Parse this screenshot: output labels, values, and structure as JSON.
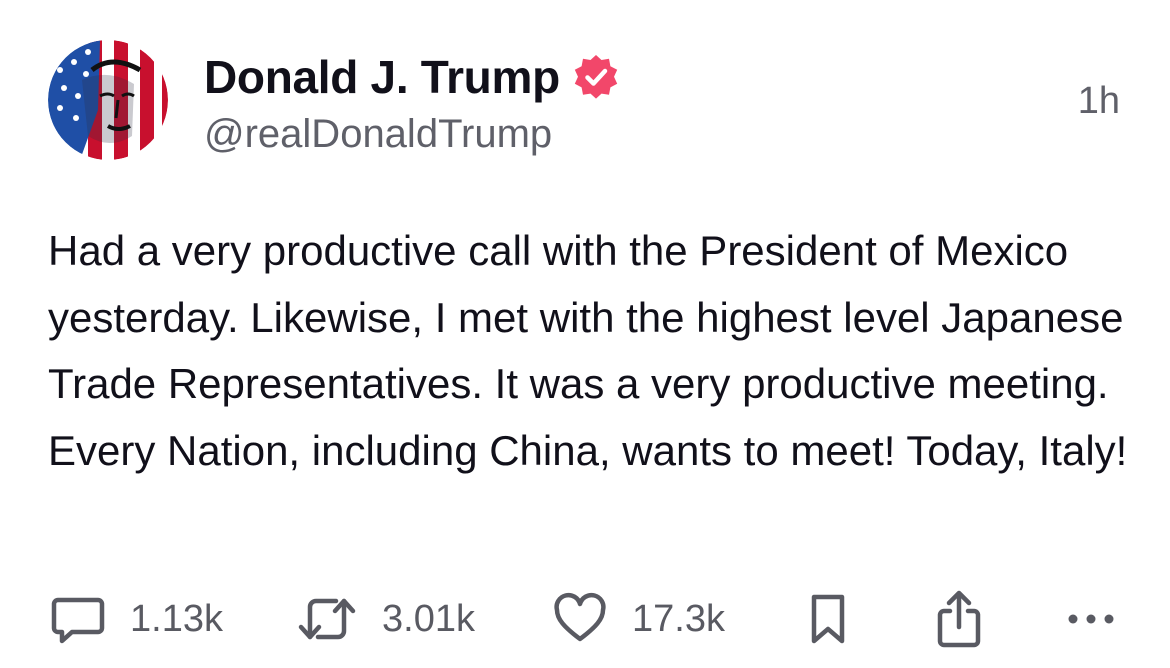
{
  "post": {
    "author_name": "Donald J. Trump",
    "handle": "@realDonaldTrump",
    "timestamp": "1h",
    "text": "Had a very productive call with the President of Mexico yesterday. Likewise, I met with the highest level Japanese Trade Representatives. It was a very productive meeting. Every Nation, including China, wants to meet! Today, Italy!"
  },
  "actions": {
    "replies": "1.13k",
    "reposts": "3.01k",
    "likes": "17.3k"
  },
  "icons": {
    "avatar": "avatar-portrait",
    "verified": "verified-badge-icon",
    "reply": "speech-bubble-icon",
    "repost": "repost-arrows-icon",
    "like": "heart-icon",
    "bookmark": "bookmark-icon",
    "share": "share-icon",
    "more": "more-dots-icon"
  },
  "colors": {
    "verified_badge": "#f2476a",
    "text_primary": "#11101a",
    "text_secondary": "#5f6069"
  }
}
